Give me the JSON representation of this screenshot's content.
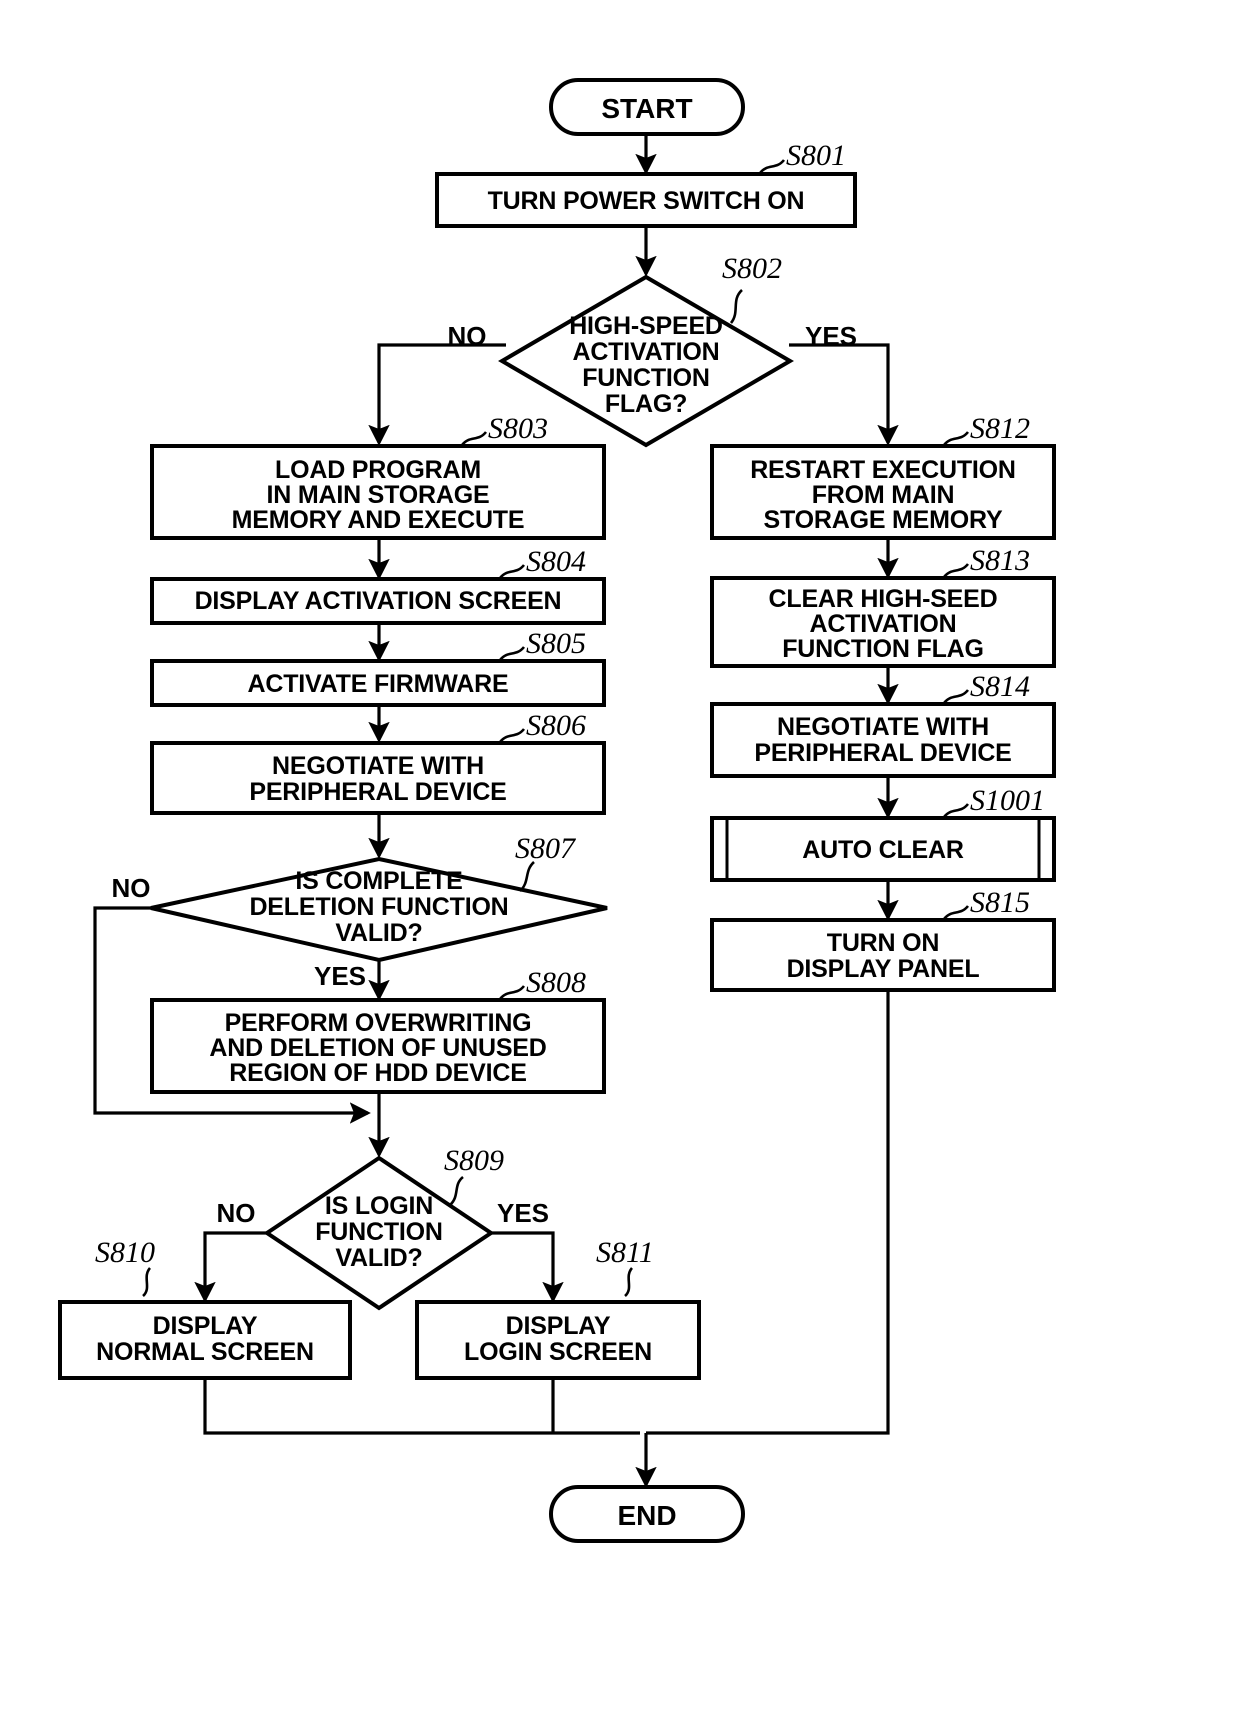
{
  "diagram": {
    "type": "flowchart",
    "title": "",
    "orientation": "top-to-bottom"
  },
  "terminators": {
    "start": "START",
    "end": "END"
  },
  "branch_labels": {
    "s802_no": "NO",
    "s802_yes": "YES",
    "s807_no": "NO",
    "s807_yes": "YES",
    "s809_no": "NO",
    "s809_yes": "YES"
  },
  "steps": {
    "s801": {
      "id": "S801",
      "shape": "process",
      "lines": [
        "TURN POWER SWITCH ON"
      ]
    },
    "s802": {
      "id": "S802",
      "shape": "decision",
      "lines": [
        "HIGH-SPEED",
        "ACTIVATION",
        "FUNCTION",
        "FLAG?"
      ]
    },
    "s803": {
      "id": "S803",
      "shape": "process",
      "lines": [
        "LOAD PROGRAM",
        "IN MAIN STORAGE",
        "MEMORY AND EXECUTE"
      ]
    },
    "s804": {
      "id": "S804",
      "shape": "process",
      "lines": [
        "DISPLAY ACTIVATION SCREEN"
      ]
    },
    "s805": {
      "id": "S805",
      "shape": "process",
      "lines": [
        "ACTIVATE FIRMWARE"
      ]
    },
    "s806": {
      "id": "S806",
      "shape": "process",
      "lines": [
        "NEGOTIATE WITH",
        "PERIPHERAL DEVICE"
      ]
    },
    "s807": {
      "id": "S807",
      "shape": "decision",
      "lines": [
        "IS COMPLETE",
        "DELETION FUNCTION",
        "VALID?"
      ]
    },
    "s808": {
      "id": "S808",
      "shape": "process",
      "lines": [
        "PERFORM OVERWRITING",
        "AND DELETION OF UNUSED",
        "REGION OF HDD DEVICE"
      ]
    },
    "s809": {
      "id": "S809",
      "shape": "decision",
      "lines": [
        "IS LOGIN",
        "FUNCTION",
        "VALID?"
      ]
    },
    "s810": {
      "id": "S810",
      "shape": "process",
      "lines": [
        "DISPLAY",
        "NORMAL SCREEN"
      ]
    },
    "s811": {
      "id": "S811",
      "shape": "process",
      "lines": [
        "DISPLAY",
        "LOGIN SCREEN"
      ]
    },
    "s812": {
      "id": "S812",
      "shape": "process",
      "lines": [
        "RESTART EXECUTION",
        "FROM MAIN",
        "STORAGE MEMORY"
      ]
    },
    "s813": {
      "id": "S813",
      "shape": "process",
      "lines": [
        "CLEAR HIGH-SEED",
        "ACTIVATION",
        "FUNCTION FLAG"
      ]
    },
    "s814": {
      "id": "S814",
      "shape": "process",
      "lines": [
        "NEGOTIATE WITH",
        "PERIPHERAL DEVICE"
      ]
    },
    "s1001": {
      "id": "S1001",
      "shape": "predefined-process",
      "lines": [
        "AUTO CLEAR"
      ]
    },
    "s815": {
      "id": "S815",
      "shape": "process",
      "lines": [
        "TURN ON",
        "DISPLAY PANEL"
      ]
    }
  },
  "colors": {
    "stroke": "#000000",
    "fill": "#ffffff",
    "text": "#000000"
  }
}
